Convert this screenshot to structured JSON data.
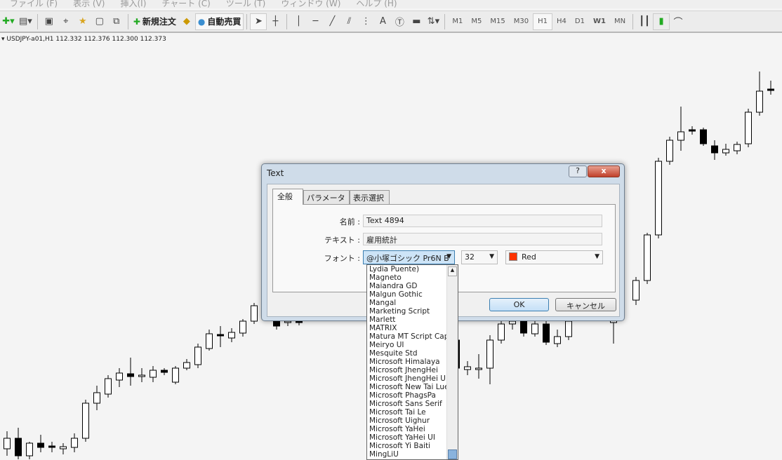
{
  "menu": [
    "ファイル (F)",
    "表示 (V)",
    "挿入(I)",
    "チャート (C)",
    "ツール (T)",
    "ウィンドウ (W)",
    "ヘルプ (H)"
  ],
  "toolbar": {
    "new_order": "新規注文",
    "auto_trade": "自動売買",
    "text_tool": "A",
    "timeframes": [
      "M1",
      "M5",
      "M15",
      "M30",
      "H1",
      "H4",
      "D1",
      "W1",
      "MN"
    ],
    "active_timeframe": "H1"
  },
  "symbol_info": "USDJPY-a01,H1  112.332 112.376 112.300 112.373",
  "dialog": {
    "title": "Text",
    "help": "?",
    "close": "x",
    "tabs": [
      "全般",
      "パラメーター",
      "表示選択"
    ],
    "name_label": "名前 :",
    "name_value": "Text 4894",
    "text_label": "テキスト :",
    "text_value": "雇用統計",
    "font_label": "フォント :",
    "font_value": "@小塚ゴシック Pr6N B",
    "font_size": "32",
    "color_name": "Red",
    "color_hex": "#ff3300",
    "ok": "OK",
    "cancel": "キャンセル",
    "font_options": [
      "Lydia Puente)",
      "Magneto",
      "Maiandra GD",
      "Malgun Gothic",
      "Mangal",
      "Marketing Script",
      "Marlett",
      "MATRIX",
      "Matura MT Script Cap",
      "Meiryo UI",
      "Mesquite Std",
      "Microsoft Himalaya",
      "Microsoft JhengHei",
      "Microsoft JhengHei UI",
      "Microsoft New Tai Lue",
      "Microsoft PhagsPa",
      "Microsoft Sans Serif",
      "Microsoft Tai Le",
      "Microsoft Uighur",
      "Microsoft YaHei",
      "Microsoft YaHei UI",
      "Microsoft Yi Baiti",
      "MingLiU"
    ]
  },
  "chart_data": {
    "type": "candlestick",
    "symbol": "USDJPY-a01",
    "timeframe": "H1",
    "fields": [
      "bar_index",
      "open",
      "high",
      "low",
      "close"
    ],
    "candles": [
      [
        0,
        111.86,
        111.885,
        111.85,
        111.875
      ],
      [
        1,
        111.875,
        111.89,
        111.845,
        111.85
      ],
      [
        2,
        111.85,
        111.87,
        111.845,
        111.868
      ],
      [
        3,
        111.868,
        111.88,
        111.855,
        111.862
      ],
      [
        4,
        111.864,
        111.87,
        111.855,
        111.862
      ],
      [
        5,
        111.86,
        111.868,
        111.852,
        111.863
      ],
      [
        6,
        111.862,
        111.882,
        111.855,
        111.875
      ],
      [
        7,
        111.875,
        111.93,
        111.87,
        111.925
      ],
      [
        8,
        111.925,
        111.95,
        111.915,
        111.94
      ],
      [
        9,
        111.938,
        111.965,
        111.933,
        111.96
      ],
      [
        10,
        111.958,
        111.975,
        111.948,
        111.968
      ],
      [
        11,
        111.967,
        111.99,
        111.95,
        111.963
      ],
      [
        12,
        111.963,
        111.975,
        111.955,
        111.965
      ],
      [
        13,
        111.962,
        111.978,
        111.955,
        111.972
      ],
      [
        14,
        111.972,
        111.975,
        111.965,
        111.969
      ],
      [
        15,
        111.955,
        111.978,
        111.952,
        111.975
      ],
      [
        16,
        111.975,
        111.988,
        111.972,
        111.983
      ],
      [
        17,
        111.98,
        112.01,
        111.975,
        112.005
      ],
      [
        18,
        112.003,
        112.03,
        112.0,
        112.024
      ],
      [
        19,
        112.023,
        112.035,
        112.005,
        112.021
      ],
      [
        20,
        112.018,
        112.032,
        112.012,
        112.026
      ],
      [
        21,
        112.025,
        112.045,
        112.02,
        112.042
      ],
      [
        22,
        112.042,
        112.068,
        112.038,
        112.064
      ],
      [
        24,
        112.045,
        112.05,
        112.03,
        112.035
      ],
      [
        25,
        112.04,
        112.045,
        112.035,
        112.042
      ],
      [
        26,
        112.042,
        112.046,
        112.036,
        112.04
      ],
      [
        40,
        112.015,
        112.02,
        111.97,
        111.975
      ],
      [
        41,
        111.973,
        111.985,
        111.965,
        111.977
      ],
      [
        42,
        111.973,
        111.995,
        111.96,
        111.975
      ],
      [
        43,
        111.975,
        112.022,
        111.952,
        112.015
      ],
      [
        44,
        112.015,
        112.045,
        112.01,
        112.038
      ],
      [
        45,
        112.038,
        112.046,
        112.03,
        112.042
      ],
      [
        46,
        112.042,
        112.048,
        112.02,
        112.025
      ],
      [
        47,
        112.024,
        112.042,
        112.02,
        112.038
      ],
      [
        48,
        112.038,
        112.044,
        112.008,
        112.012
      ],
      [
        49,
        112.01,
        112.03,
        112.005,
        112.02
      ],
      [
        50,
        112.02,
        112.045,
        112.015,
        112.042
      ],
      [
        54,
        112.04,
        112.06,
        112.01,
        112.045
      ],
      [
        56,
        112.072,
        112.105,
        112.065,
        112.1
      ],
      [
        57,
        112.1,
        112.168,
        112.095,
        112.165
      ],
      [
        58,
        112.165,
        112.275,
        112.16,
        112.27
      ],
      [
        59,
        112.27,
        112.305,
        112.265,
        112.3
      ],
      [
        60,
        112.3,
        112.348,
        112.285,
        112.312
      ],
      [
        61,
        112.315,
        112.32,
        112.308,
        112.313
      ],
      [
        62,
        112.315,
        112.318,
        112.292,
        112.295
      ],
      [
        63,
        112.292,
        112.3,
        112.272,
        112.282
      ],
      [
        64,
        112.282,
        112.295,
        112.278,
        112.287
      ],
      [
        65,
        112.285,
        112.298,
        112.28,
        112.294
      ],
      [
        66,
        112.295,
        112.345,
        112.29,
        112.34
      ],
      [
        67,
        112.34,
        112.398,
        112.335,
        112.37
      ],
      [
        68,
        112.373,
        112.385,
        112.365,
        112.371
      ]
    ]
  }
}
